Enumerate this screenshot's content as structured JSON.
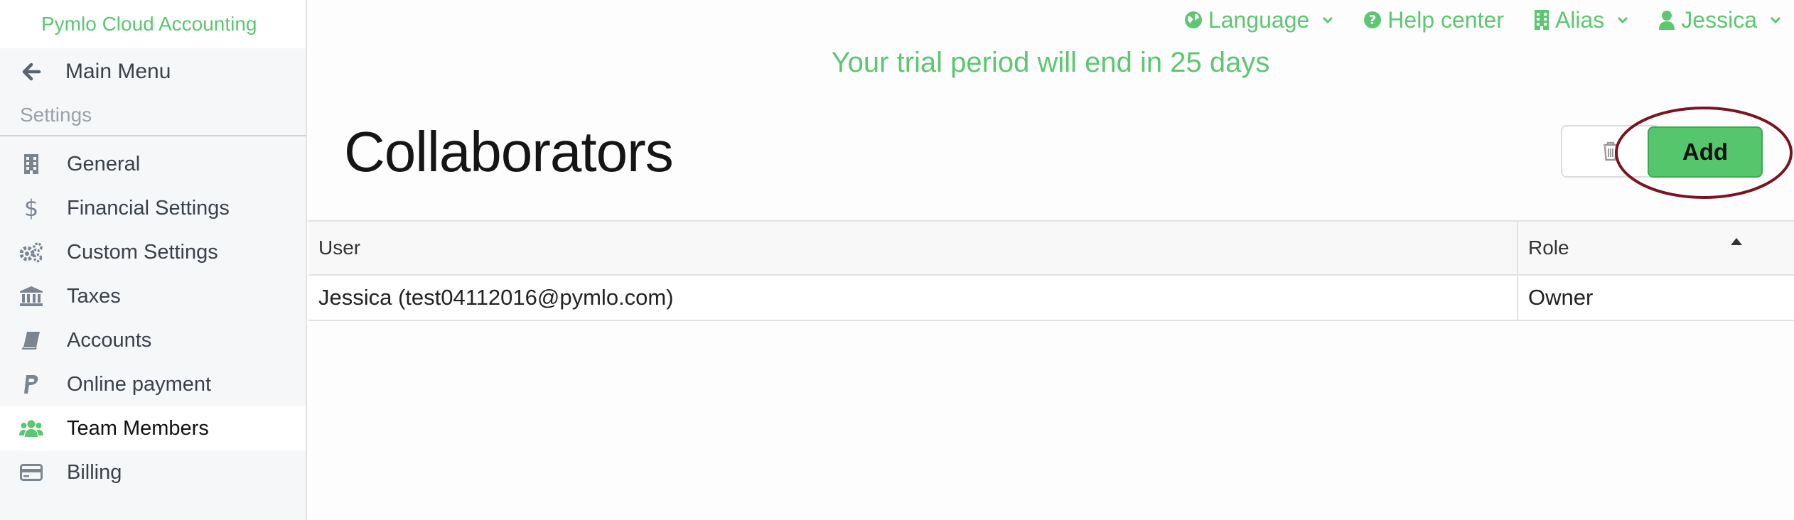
{
  "sidebar": {
    "brand": "Pymlo Cloud Accounting",
    "main_menu": "Main Menu",
    "section": "Settings",
    "items": [
      {
        "label": "General",
        "icon": "building-icon"
      },
      {
        "label": "Financial Settings",
        "icon": "dollar-icon"
      },
      {
        "label": "Custom Settings",
        "icon": "gears-icon"
      },
      {
        "label": "Taxes",
        "icon": "bank-icon"
      },
      {
        "label": "Accounts",
        "icon": "book-icon"
      },
      {
        "label": "Online payment",
        "icon": "paypal-icon"
      },
      {
        "label": "Team Members",
        "icon": "users-icon",
        "active": true
      },
      {
        "label": "Billing",
        "icon": "credit-card-icon"
      }
    ]
  },
  "topbar": {
    "language": "Language",
    "help": "Help center",
    "alias": "Alias",
    "user": "Jessica"
  },
  "trial_message": "Your trial period will end in 25 days",
  "page": {
    "title": "Collaborators",
    "add_label": "Add"
  },
  "table": {
    "columns": [
      "User",
      "Role"
    ],
    "rows": [
      {
        "user": "Jessica (test04112016@pymlo.com)",
        "role": "Owner"
      }
    ]
  },
  "colors": {
    "accent": "#5cc771",
    "highlight_ring": "#7a1420"
  }
}
